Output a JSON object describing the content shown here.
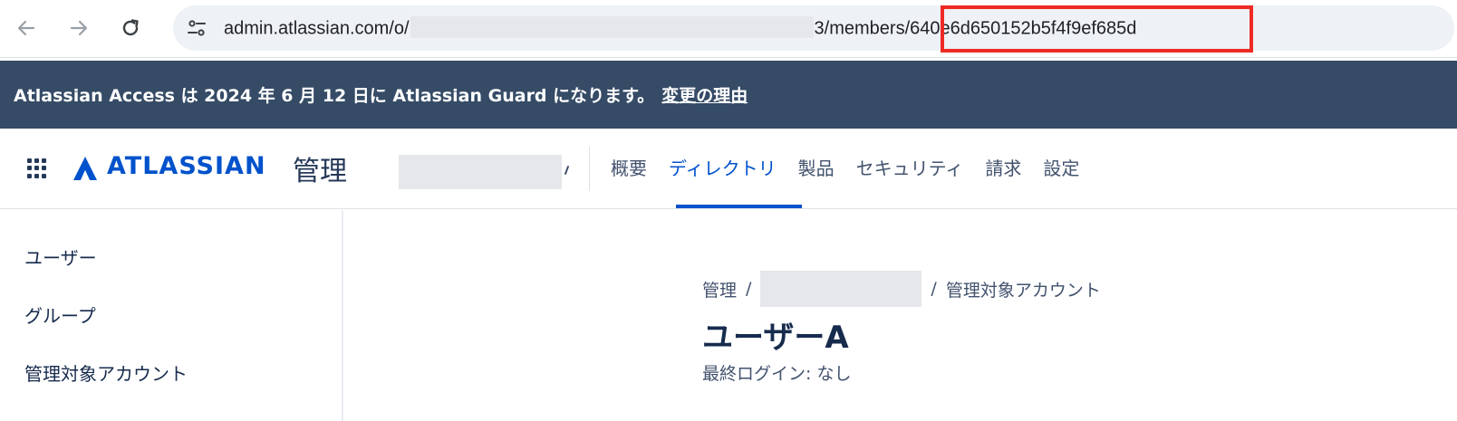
{
  "browser": {
    "url_prefix": "admin.atlassian.com/o/",
    "url_middle_end": "3/members/",
    "url_highlight": "640e6d650152b5f4f9ef685d",
    "highlight_color": "#ee2a25",
    "icons": [
      "back-arrow-icon",
      "forward-arrow-icon",
      "reload-icon",
      "site-info-icon"
    ]
  },
  "banner": {
    "message": "Atlassian Access は 2024 年 6 月 12 日に Atlassian Guard になります。",
    "link": "変更の理由",
    "background": "#354b66"
  },
  "header": {
    "logo_text": "ATLASSIAN",
    "logo_suffix": "管理",
    "tabs": [
      {
        "label": "概要"
      },
      {
        "label": "ディレクトリ"
      },
      {
        "label": "製品"
      },
      {
        "label": "セキュリティ"
      },
      {
        "label": "請求"
      },
      {
        "label": "設定"
      }
    ],
    "active_tab": "ディレクトリ",
    "accent": "#0052cc"
  },
  "sidebar": {
    "items": [
      {
        "label": "ユーザー"
      },
      {
        "label": "グループ"
      },
      {
        "label": "管理対象アカウント"
      }
    ]
  },
  "main": {
    "breadcrumb": {
      "first": "管理",
      "sep": "/",
      "last": "管理対象アカウント"
    },
    "title": "ユーザーA",
    "last_login": "最終ログイン: なし"
  }
}
